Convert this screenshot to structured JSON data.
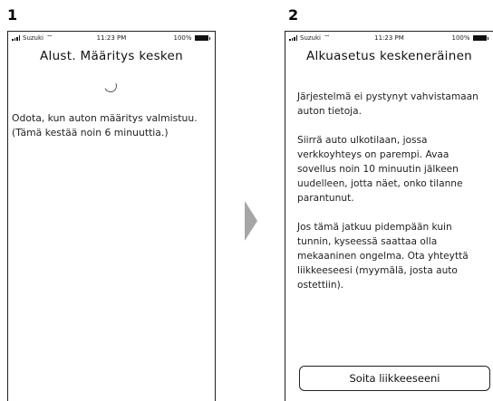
{
  "steps": [
    {
      "number": "1",
      "status": {
        "carrier": "Suzuki",
        "time": "11:23 PM",
        "battery": "100%"
      },
      "title": "Alust. Määritys kesken",
      "body": "Odota, kun auton määritys valmistuu. (Tämä kestää noin 6 minuuttia.)"
    },
    {
      "number": "2",
      "status": {
        "carrier": "Suzuki",
        "time": "11:23 PM",
        "battery": "100%"
      },
      "title": "Alkuasetus keskeneräinen",
      "paragraphs": [
        "Järjestelmä ei pystynyt vahvistamaan auton tietoja.",
        "Siirrä auto ulkotilaan, jossa verkkoyhteys on parempi. Avaa sovellus noin 10 minuutin jälkeen uudelleen, jotta näet, onko tilanne parantunut.",
        "Jos tämä jatkuu pidempään kuin tunnin, kyseessä saattaa olla mekaaninen ongelma. Ota yhteyttä liikkeeseesi (myymälä, josta auto ostettiin)."
      ],
      "button_label": "Soita liikkeeseeni"
    }
  ],
  "icons": {
    "signal": "signal-bars-icon",
    "wifi": "wifi-icon",
    "battery": "battery-icon",
    "spinner": "loading-spinner-icon",
    "arrow": "next-arrow-icon"
  },
  "colors": {
    "arrow": "#a6a6a6",
    "border": "#222222"
  }
}
